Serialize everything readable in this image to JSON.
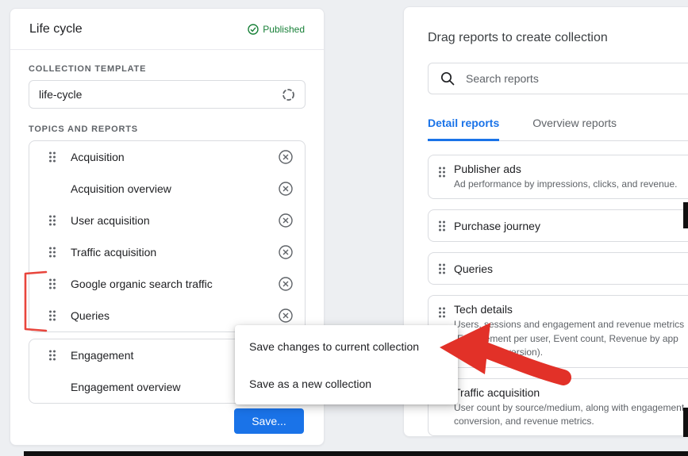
{
  "left_panel": {
    "title": "Life cycle",
    "status": "Published",
    "template_label": "COLLECTION TEMPLATE",
    "template_value": "life-cycle",
    "topics_label": "TOPICS AND REPORTS",
    "groups": [
      {
        "items": [
          {
            "label": "Acquisition"
          },
          {
            "label": "Acquisition overview"
          },
          {
            "label": "User acquisition"
          },
          {
            "label": "Traffic acquisition"
          },
          {
            "label": "Google organic search traffic"
          },
          {
            "label": "Queries"
          }
        ]
      },
      {
        "items": [
          {
            "label": "Engagement"
          },
          {
            "label": "Engagement overview"
          }
        ]
      }
    ],
    "save_button": "Save..."
  },
  "menu": {
    "items": [
      "Save changes to current collection",
      "Save as a new collection"
    ]
  },
  "right_panel": {
    "title": "Drag reports to create collection",
    "search_placeholder": "Search reports",
    "tabs": [
      {
        "label": "Detail reports"
      },
      {
        "label": "Overview reports"
      }
    ],
    "reports": [
      {
        "title": "Publisher ads",
        "description": "Ad performance by impressions, clicks, and revenue."
      },
      {
        "title": "Purchase journey",
        "description": ""
      },
      {
        "title": "Queries",
        "description": ""
      },
      {
        "title": "Tech details",
        "description": "Users, sessions and engagement and revenue metrics (Engagement per user, Event count, Revenue by app version, OS version)."
      },
      {
        "title": "Traffic acquisition",
        "description": "User count by source/medium, along with engagement, conversion, and revenue metrics."
      }
    ]
  },
  "colors": {
    "accent_blue": "#1a73e8",
    "published_green": "#188038",
    "annotation_red": "#e8453c"
  }
}
